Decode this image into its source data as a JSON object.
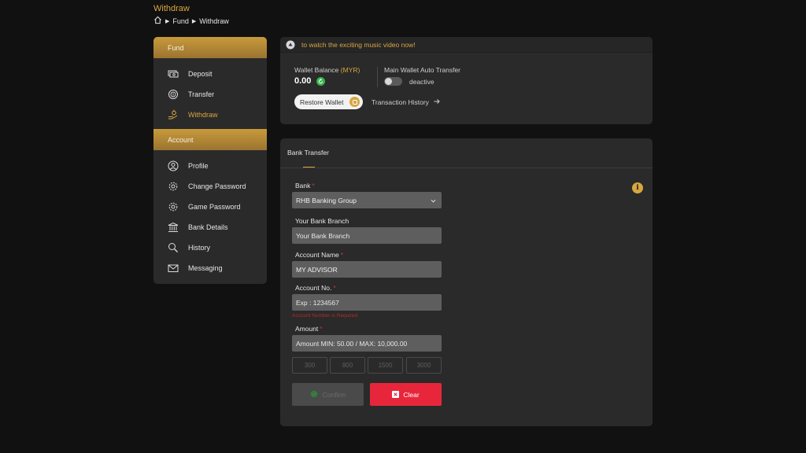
{
  "page": {
    "title": "Withdraw"
  },
  "breadcrumb": {
    "items": [
      "Fund",
      "Withdraw"
    ]
  },
  "sidebar": {
    "sections": [
      {
        "header": "Fund",
        "items": [
          {
            "label": "Deposit",
            "icon": "cash-icon"
          },
          {
            "label": "Transfer",
            "icon": "transfer-icon"
          },
          {
            "label": "Withdraw",
            "icon": "withdraw-icon",
            "active": true
          }
        ]
      },
      {
        "header": "Account",
        "items": [
          {
            "label": "Profile",
            "icon": "user-icon"
          },
          {
            "label": "Change Password",
            "icon": "gear-icon"
          },
          {
            "label": "Game Password",
            "icon": "gear-icon"
          },
          {
            "label": "Bank Details",
            "icon": "bank-icon"
          },
          {
            "label": "History",
            "icon": "search-icon"
          },
          {
            "label": "Messaging",
            "icon": "mail-icon"
          }
        ]
      }
    ]
  },
  "wallet": {
    "marquee": "to watch the exciting music video now!",
    "balance_label": "Wallet Balance",
    "currency": "(MYR)",
    "balance": "0.00",
    "auto_transfer_label": "Main Wallet Auto Transfer",
    "auto_transfer_state": "deactive",
    "restore_label": "Restore Wallet",
    "history_label": "Transaction History"
  },
  "form": {
    "tab": "Bank Transfer",
    "bank_label": "Bank",
    "bank_value": "RHB Banking Group",
    "branch_label": "Your Bank Branch",
    "branch_placeholder": "Your Bank Branch",
    "account_name_label": "Account Name",
    "account_name_value": "MY ADVISOR",
    "account_no_label": "Account No.",
    "account_no_placeholder": "Exp : 1234567",
    "account_no_error": "Account Number is Required",
    "amount_label": "Amount",
    "amount_placeholder": "Amount MIN: 50.00 / MAX: 10,000.00",
    "quick_amounts": [
      "300",
      "800",
      "1500",
      "3000"
    ],
    "confirm_label": "Confirm",
    "clear_label": "Clear"
  },
  "colors": {
    "accent": "#d8a640",
    "danger": "#e8263b",
    "success": "#35b54a"
  }
}
